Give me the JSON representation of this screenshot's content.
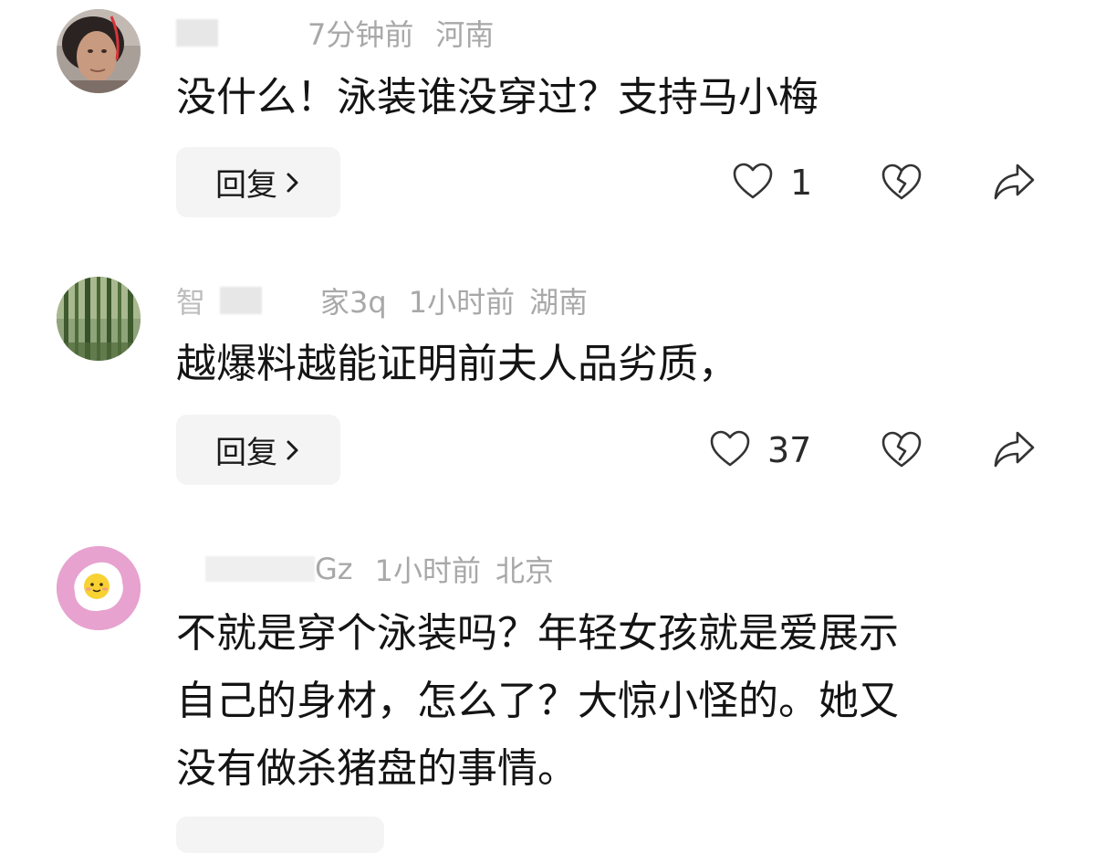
{
  "comments": [
    {
      "username_visible": "",
      "time": "7分钟前",
      "location": "河南",
      "text_lines": [
        "没什么！泳装谁没穿过？支持马小梅"
      ],
      "reply_label": "回复",
      "likes": "1"
    },
    {
      "username_prefix": "智",
      "username_suffix": "家3q",
      "time": "1小时前",
      "location": "湖南",
      "text_lines": [
        "越爆料越能证明前夫人品劣质，"
      ],
      "reply_label": "回复",
      "likes": "37"
    },
    {
      "username_suffix": "Gz",
      "time": "1小时前",
      "location": "北京",
      "text_lines": [
        "不就是穿个泳装吗？年轻女孩就是爱展示",
        "自己的身材，怎么了？大惊小怪的。她又",
        "没有做杀猪盘的事情。"
      ]
    }
  ],
  "icons": {
    "like": "heart-outline-icon",
    "dislike": "broken-heart-icon",
    "share": "share-arrow-icon",
    "chevron": "chevron-right-icon"
  },
  "colors": {
    "meta_text": "#a8a8a8",
    "reply_bg": "#f4f4f4",
    "avatar3_bg": "#e7a2cf"
  }
}
